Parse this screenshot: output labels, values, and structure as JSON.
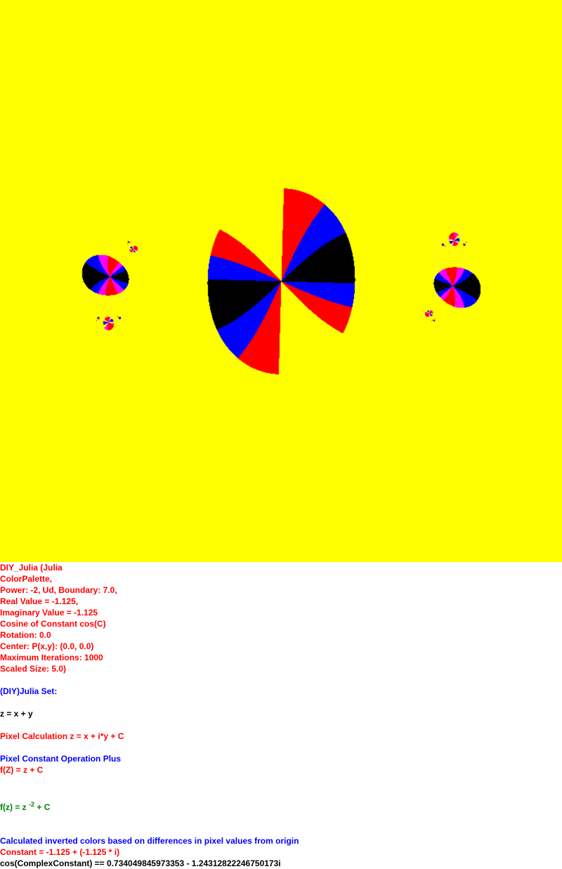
{
  "image": {
    "subject": "julia-set-fractal",
    "palette": [
      "#ffff00",
      "#000000",
      "#ff0000",
      "#0000ff",
      "#ff00ff"
    ]
  },
  "info": {
    "title": "DIY_Julia (Julia",
    "palette_label": "ColorPalette,",
    "power_line": "Power: -2, Ud, Boundary: 7.0,",
    "real_value": "Real Value = -1.125,",
    "imaginary_value": "Imaginary Value = -1.125",
    "cosine_constant": "Cosine of Constant cos(C)",
    "rotation": "Rotation: 0.0",
    "center": "Center: P(x,y): (0.0, 0.0)",
    "max_iterations": "Maximum Iterations: 1000",
    "scaled_size": "Scaled Size: 5.0)"
  },
  "formula": {
    "set_name": "(DIY)Julia Set:",
    "z_def": "z = x + y",
    "pixel_calc": "Pixel Calculation z = x + i*y + C",
    "operation": "Pixel Constant Operation Plus",
    "fz": "f(Z) = z + C",
    "fz_prefix": "f(z) = z",
    "fz_exponent": "-2",
    "fz_suffix": " + C"
  },
  "footer": {
    "colors_note": "Calculated inverted colors based on differences in pixel values from origin",
    "constant": "Constant = -1.125 + (-1.125 * i)",
    "cos_constant": "cos(ComplexConstant) == 0.734049845973353 - 1.24312822246750173i"
  }
}
